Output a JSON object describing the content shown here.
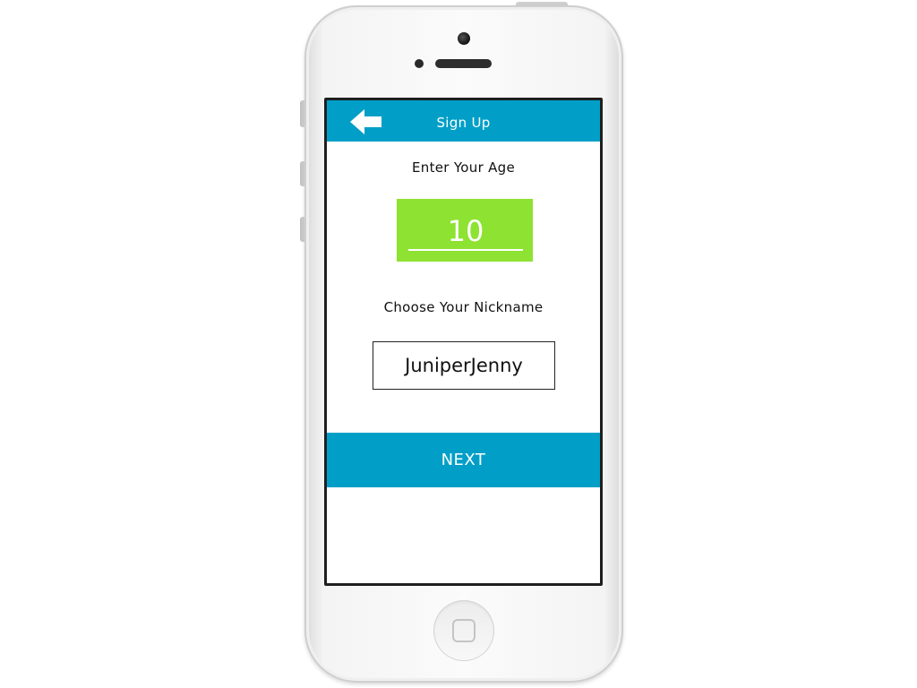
{
  "header": {
    "title": "Sign Up",
    "back_icon": "arrow-left-icon"
  },
  "age": {
    "label": "Enter Your Age",
    "value": "10"
  },
  "nickname": {
    "label": "Choose Your Nickname",
    "value": "JuniperJenny"
  },
  "actions": {
    "next_label": "NEXT"
  },
  "colors": {
    "accent": "#019fc7",
    "age_box": "#8ee231"
  }
}
